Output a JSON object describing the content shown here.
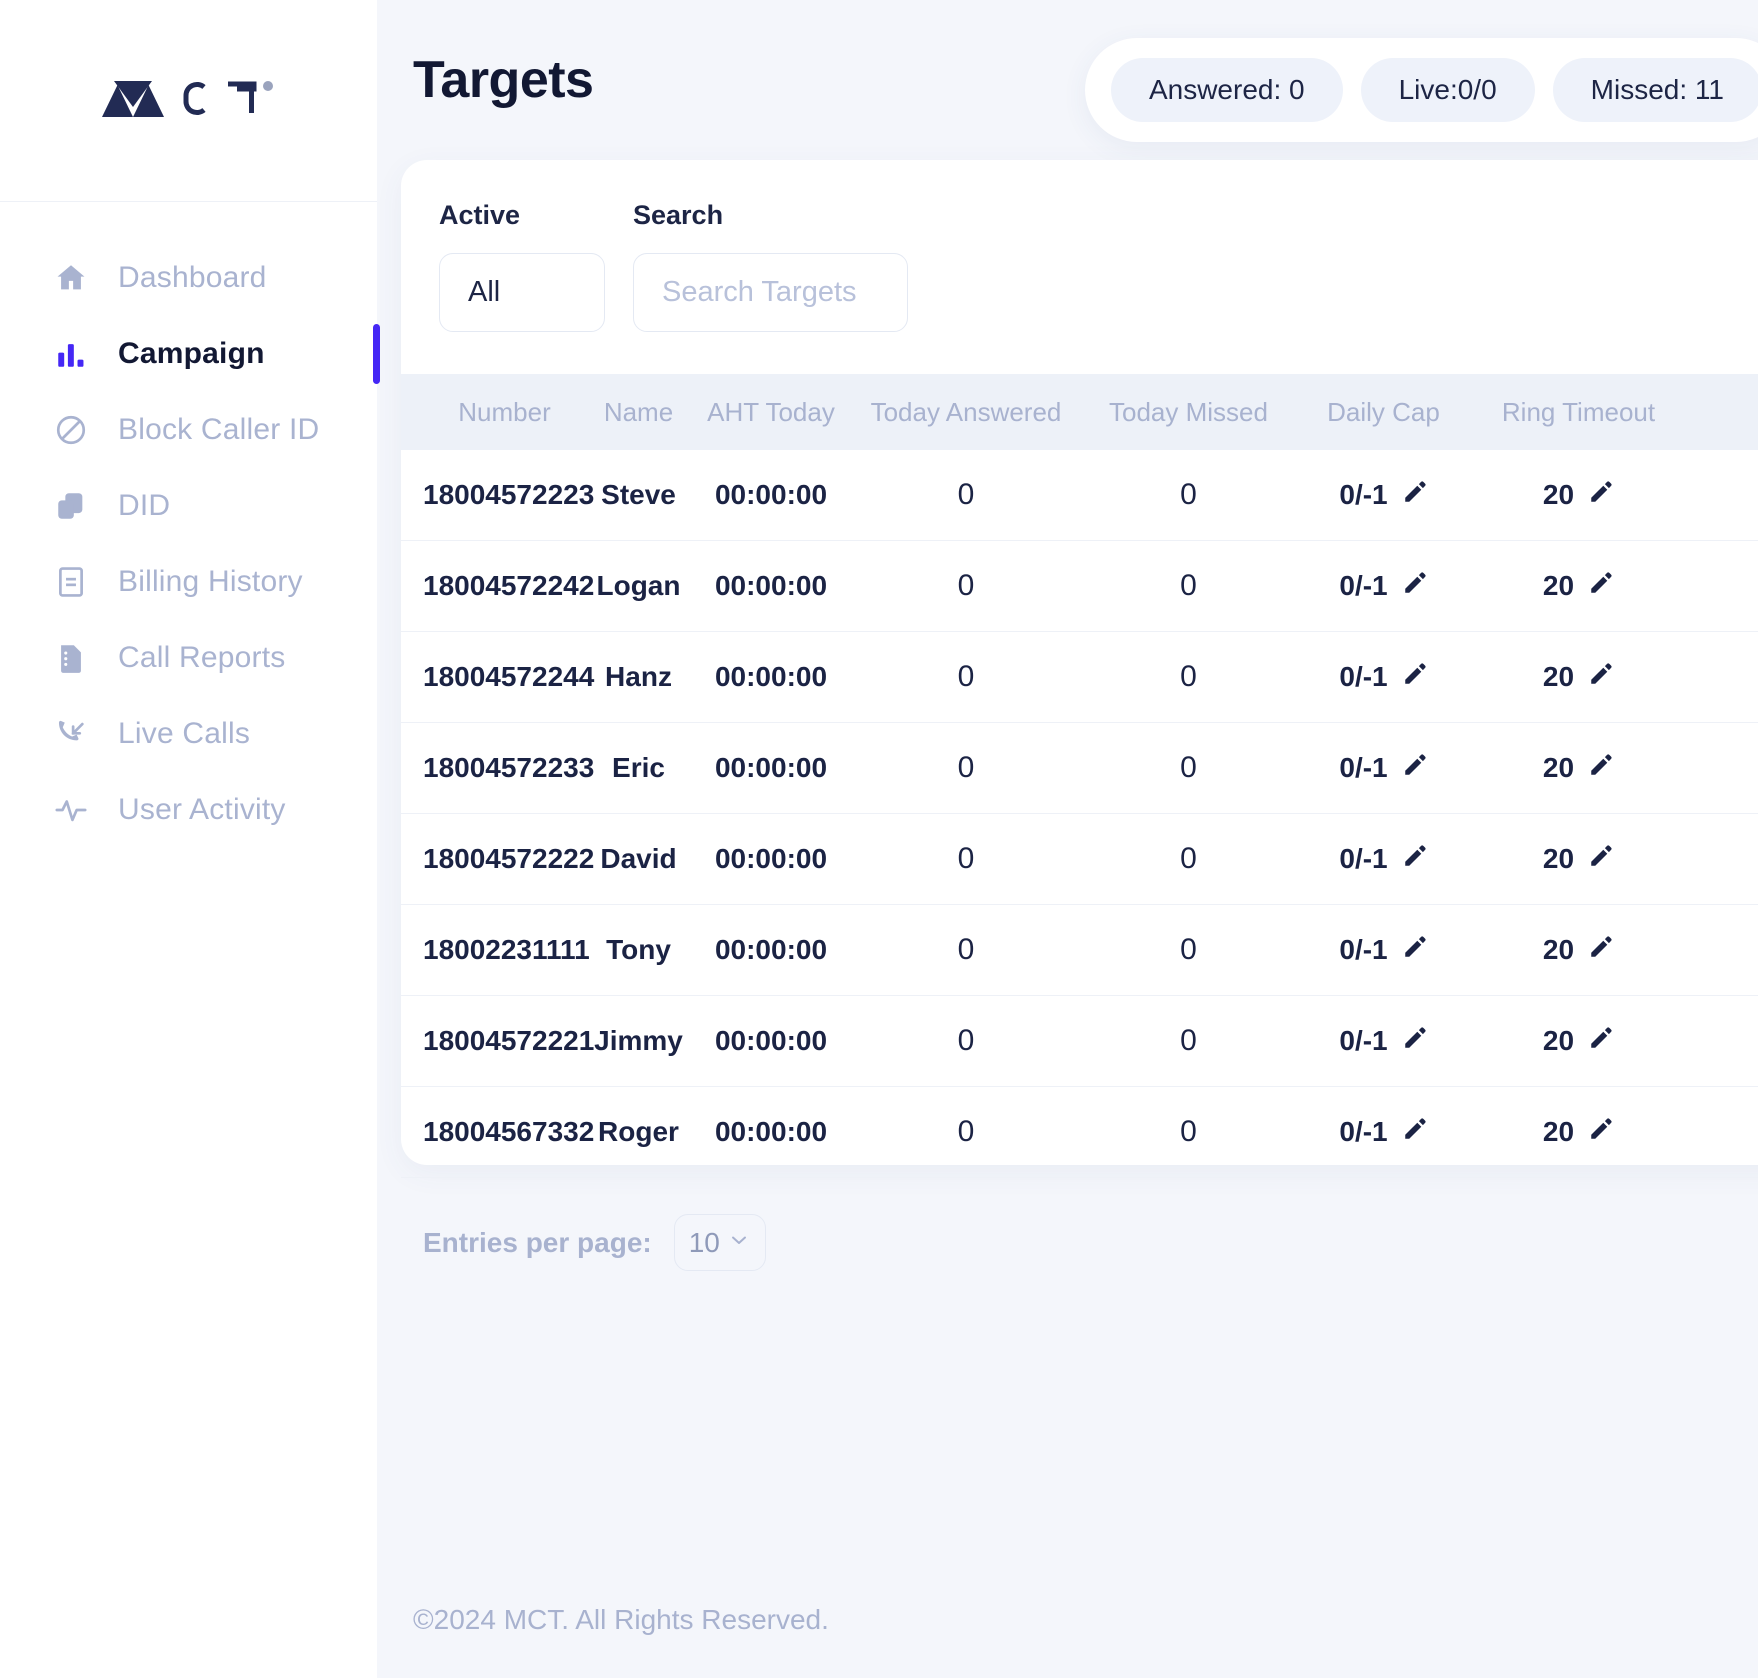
{
  "brand": {
    "name": "MCT",
    "logo_icon": "mct-logo"
  },
  "sidebar": {
    "items": [
      {
        "label": "Dashboard",
        "icon": "home-icon",
        "active": false
      },
      {
        "label": "Campaign",
        "icon": "bar-chart-icon",
        "active": true
      },
      {
        "label": "Block Caller ID",
        "icon": "block-icon",
        "active": false
      },
      {
        "label": "DID",
        "icon": "documents-icon",
        "active": false
      },
      {
        "label": "Billing History",
        "icon": "file-lines-icon",
        "active": false
      },
      {
        "label": "Call Reports",
        "icon": "file-report-icon",
        "active": false
      },
      {
        "label": "Live Calls",
        "icon": "phone-incoming-icon",
        "active": false
      },
      {
        "label": "User Activity",
        "icon": "activity-pulse-icon",
        "active": false
      }
    ]
  },
  "header": {
    "title": "Targets",
    "stats": [
      {
        "label": "Answered: 0"
      },
      {
        "label": "Live:0/0"
      },
      {
        "label": "Missed: 11"
      }
    ]
  },
  "filters": {
    "active_label": "Active",
    "active_value": "All",
    "search_label": "Search",
    "search_value": "",
    "search_placeholder": "Search Targets"
  },
  "table": {
    "columns": [
      "Number",
      "Name",
      "AHT Today",
      "Today Answered",
      "Today Missed",
      "Daily Cap",
      "Ring Timeout"
    ],
    "rows": [
      {
        "number": "18004572223",
        "name": "Steve",
        "aht": "00:00:00",
        "answered": "0",
        "missed": "0",
        "cap": "0/-1",
        "ring": "20"
      },
      {
        "number": "18004572242",
        "name": "Logan",
        "aht": "00:00:00",
        "answered": "0",
        "missed": "0",
        "cap": "0/-1",
        "ring": "20"
      },
      {
        "number": "18004572244",
        "name": "Hanz",
        "aht": "00:00:00",
        "answered": "0",
        "missed": "0",
        "cap": "0/-1",
        "ring": "20"
      },
      {
        "number": "18004572233",
        "name": "Eric",
        "aht": "00:00:00",
        "answered": "0",
        "missed": "0",
        "cap": "0/-1",
        "ring": "20"
      },
      {
        "number": "18004572222",
        "name": "David",
        "aht": "00:00:00",
        "answered": "0",
        "missed": "0",
        "cap": "0/-1",
        "ring": "20"
      },
      {
        "number": "18002231111",
        "name": "Tony",
        "aht": "00:00:00",
        "answered": "0",
        "missed": "0",
        "cap": "0/-1",
        "ring": "20"
      },
      {
        "number": "18004572221",
        "name": "Jimmy",
        "aht": "00:00:00",
        "answered": "0",
        "missed": "0",
        "cap": "0/-1",
        "ring": "20"
      },
      {
        "number": "18004567332",
        "name": "Roger",
        "aht": "00:00:00",
        "answered": "0",
        "missed": "0",
        "cap": "0/-1",
        "ring": "20"
      }
    ]
  },
  "pagination": {
    "label": "Entries per page:",
    "value": "10"
  },
  "footer": {
    "copyright": "©2024 MCT. All Rights Reserved."
  },
  "colors": {
    "accent": "#4527f5",
    "text_dark": "#121833",
    "text_muted": "#a8b2cf",
    "page_bg": "#f4f6fb",
    "header_row_bg": "#edf1f8"
  }
}
